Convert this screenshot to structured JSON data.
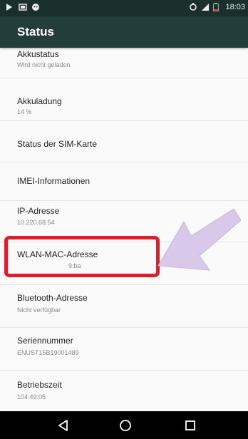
{
  "status_bar": {
    "time": "18:03",
    "icons": [
      "play-icon",
      "sim-icon",
      "android-icon",
      "sync-icon",
      "signal-icon",
      "battery-icon"
    ]
  },
  "app_bar": {
    "title": "Status"
  },
  "items": [
    {
      "title": "Akkustatus",
      "subtitle": "Wird nicht geladen"
    },
    {
      "title": "Akkuladung",
      "subtitle": "14 %"
    },
    {
      "title": "Status der SIM-Karte",
      "subtitle": ""
    },
    {
      "title": "IMEI-Informationen",
      "subtitle": ""
    },
    {
      "title": "IP-Adresse",
      "subtitle": "10.220.68.54"
    },
    {
      "title": "WLAN-MAC-Adresse",
      "subtitle": "9:ba"
    },
    {
      "title": "Bluetooth-Adresse",
      "subtitle": "Nicht verfügbar"
    },
    {
      "title": "Seriennummer",
      "subtitle": "ENUST15B19001489"
    },
    {
      "title": "Betriebszeit",
      "subtitle": "104:49:05"
    }
  ],
  "navigation": {
    "back_icon": "back-triangle-icon",
    "home_icon": "home-circle-icon",
    "recents_icon": "recents-square-icon"
  },
  "colors": {
    "status_bar": "#1b2f2c",
    "app_bar": "#233d3a",
    "highlight": "#e31b2b",
    "arrow": "#d8c9ea"
  }
}
